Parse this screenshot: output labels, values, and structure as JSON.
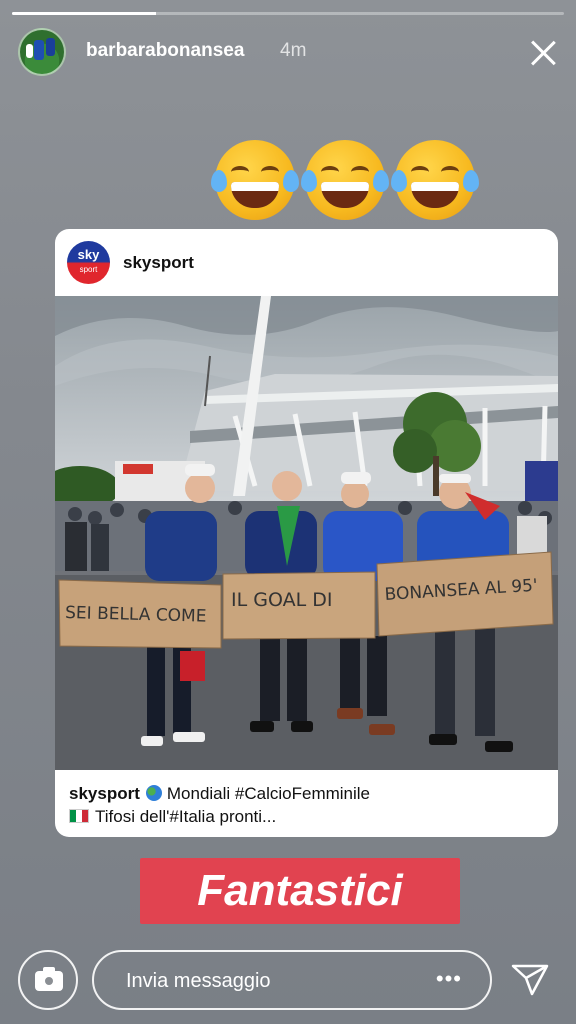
{
  "story": {
    "username": "barbarabonansea",
    "time": "4m",
    "progress": 0.26,
    "emojis": [
      "face-with-tears-of-joy",
      "face-with-tears-of-joy",
      "face-with-tears-of-joy"
    ]
  },
  "post": {
    "account": "skysport",
    "logo_top": "sky",
    "logo_bottom": "sport",
    "photo_signs": [
      "SEI BELLA COME",
      "IL GOAL DI",
      "BONANSEA AL 95'"
    ],
    "caption_user": "skysport",
    "caption_line1": "Mondiali #CalcioFemminile",
    "caption_line2": "Tifosi dell'#Italia pronti..."
  },
  "sticker": {
    "text": "Fantastici",
    "color": "#e14350"
  },
  "footer": {
    "message_placeholder": "Invia messaggio",
    "more_dots": "•••"
  }
}
